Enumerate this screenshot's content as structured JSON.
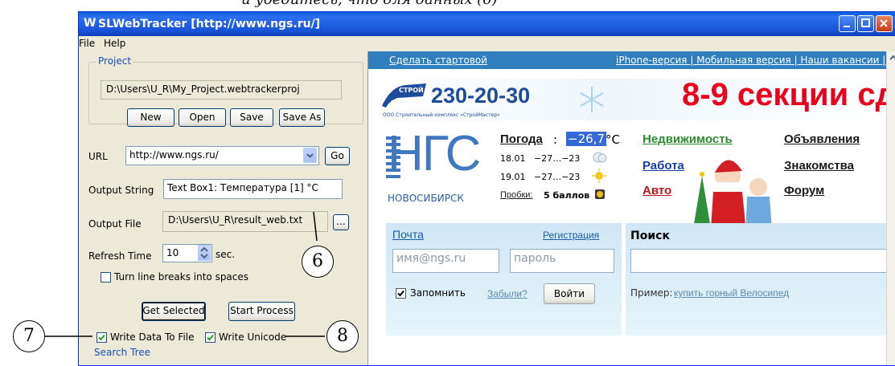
{
  "caption_top": "и убедитесь, что для данных (6)",
  "window": {
    "title": "SLWebTracker [http://www.ngs.ru/]",
    "icon_name": "app-logo-icon",
    "controls": [
      "minimize-icon",
      "maximize-icon",
      "close-icon"
    ]
  },
  "menu": {
    "items": [
      "File",
      "Help"
    ]
  },
  "project": {
    "group_label": "Project",
    "path": "D:\\Users\\U_R\\My_Project.webtrackerproj",
    "buttons": {
      "new": "New",
      "open": "Open",
      "save": "Save",
      "save_as": "Save As"
    }
  },
  "url": {
    "label": "URL",
    "value": "http://www.ngs.ru/",
    "go": "Go"
  },
  "output_string": {
    "label": "Output String",
    "value": "Text Box1: Температура [1] °C"
  },
  "output_file": {
    "label": "Output File",
    "value": "D:\\Users\\U_R\\result_web.txt",
    "browse": "..."
  },
  "refresh": {
    "label": "Refresh Time",
    "value": "10",
    "unit": "sec."
  },
  "line_breaks": {
    "label": "Turn line breaks into spaces",
    "checked": false
  },
  "actions": {
    "get_selected": "Get Selected",
    "start_process": "Start Process"
  },
  "write_data": {
    "label": "Write Data To File",
    "checked": true
  },
  "write_unicode": {
    "label": "Write Unicode",
    "checked": true
  },
  "search_tree_label": "Search Tree",
  "callouts": {
    "six": "6",
    "seven": "7",
    "eight": "8"
  },
  "web": {
    "top_left": "Сделать стартовой",
    "top_right": "iPhone-версия | Мобильная версия | Наши вакансии | Раз",
    "banner_phone": "230-20-30",
    "banner_logo_top": "СТРОЙ",
    "banner_logo_bottom": "МАСТЕР",
    "banner_sub": "ООО Строительный комплекс «СтройМастер»",
    "banner_right": "8-9 секции сд",
    "ngs_logo": "НГС",
    "ngs_city": "НОВОСИБИРСК",
    "weather_label": "Погода",
    "weather_sep": ":",
    "weather_temp": "−26,7",
    "weather_unit": "°C",
    "forecast": [
      {
        "date": "18.01",
        "range": "−27…−23"
      },
      {
        "date": "19.01",
        "range": "−27…−23"
      }
    ],
    "traffic_label": "Пробки:",
    "traffic_value": "5 баллов",
    "links_col1": [
      "Недвижимость",
      "Работа",
      "Авто"
    ],
    "links_col2": [
      "Объявления",
      "Знакомства",
      "Форум"
    ],
    "colors": {
      "green": "#2e8b2e",
      "blue": "#1a3fa0",
      "red": "#c0161a",
      "dark": "#1a1a1a",
      "accent": "#e8001c"
    },
    "mail_title": "Почта",
    "register": "Регистрация",
    "email_placeholder": "имя@ngs.ru",
    "password_placeholder": "пароль",
    "remember": "Запомнить",
    "forgot": "Забыли?",
    "login": "Войти",
    "search_title": "Поиск",
    "example_label": "Пример:",
    "example_link": "купить горный Велосипед"
  }
}
